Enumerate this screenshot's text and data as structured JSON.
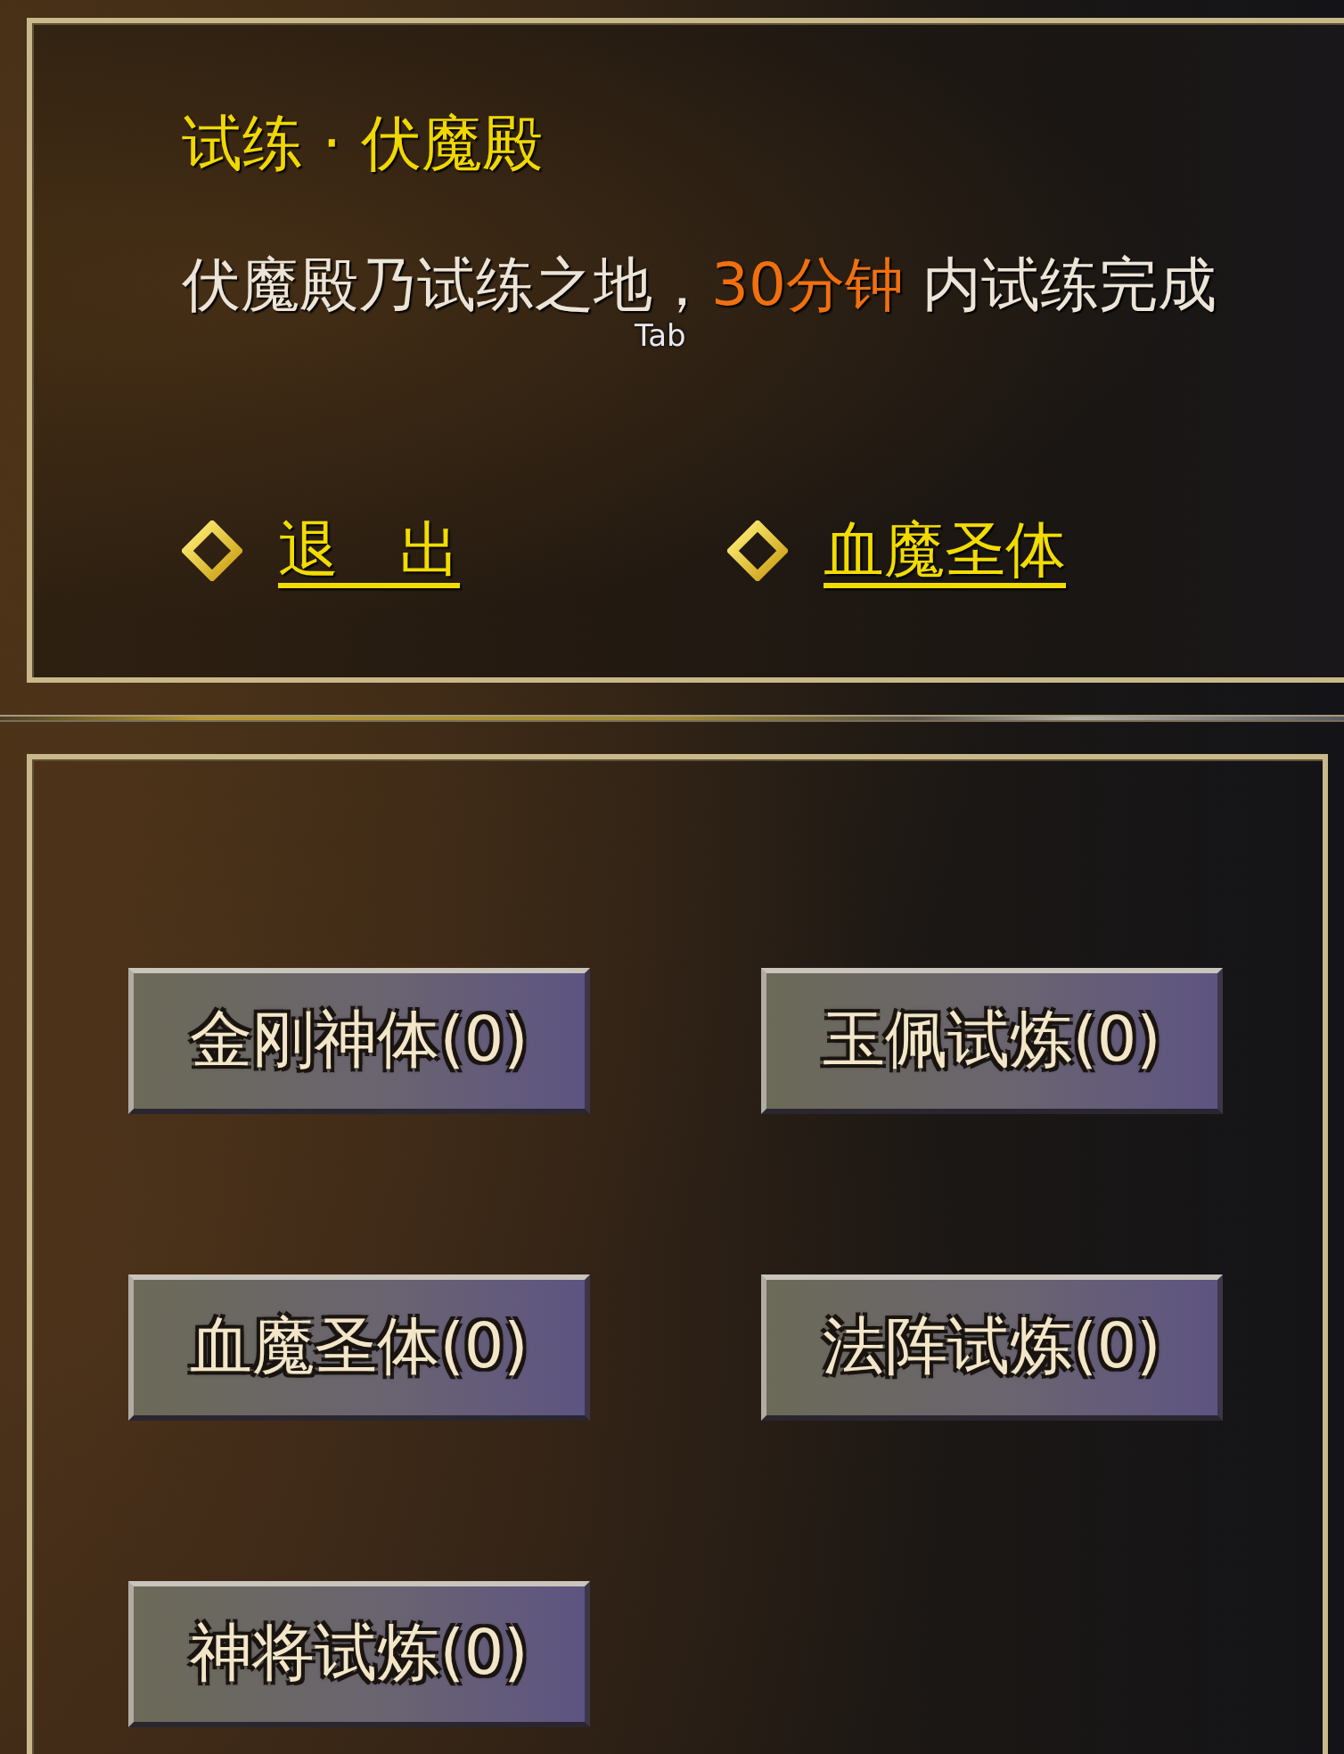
{
  "panel": {
    "title": "试练 · 伏魔殿",
    "description": [
      {
        "text": "伏魔殿乃试练之地，",
        "kind": "plain"
      },
      {
        "text": "30分钟",
        "kind": "highlight"
      },
      {
        "text": " 内试练完成",
        "kind": "plain"
      }
    ],
    "key_hint": "Tab",
    "links": [
      {
        "label": "退　出"
      },
      {
        "label": "血魔圣体"
      }
    ]
  },
  "trials": [
    {
      "label": "金刚神体(0)"
    },
    {
      "label": "玉佩试炼(0)"
    },
    {
      "label": "血魔圣体(0)"
    },
    {
      "label": "法阵试炼(0)"
    },
    {
      "label": "神将试炼(0)"
    }
  ]
}
